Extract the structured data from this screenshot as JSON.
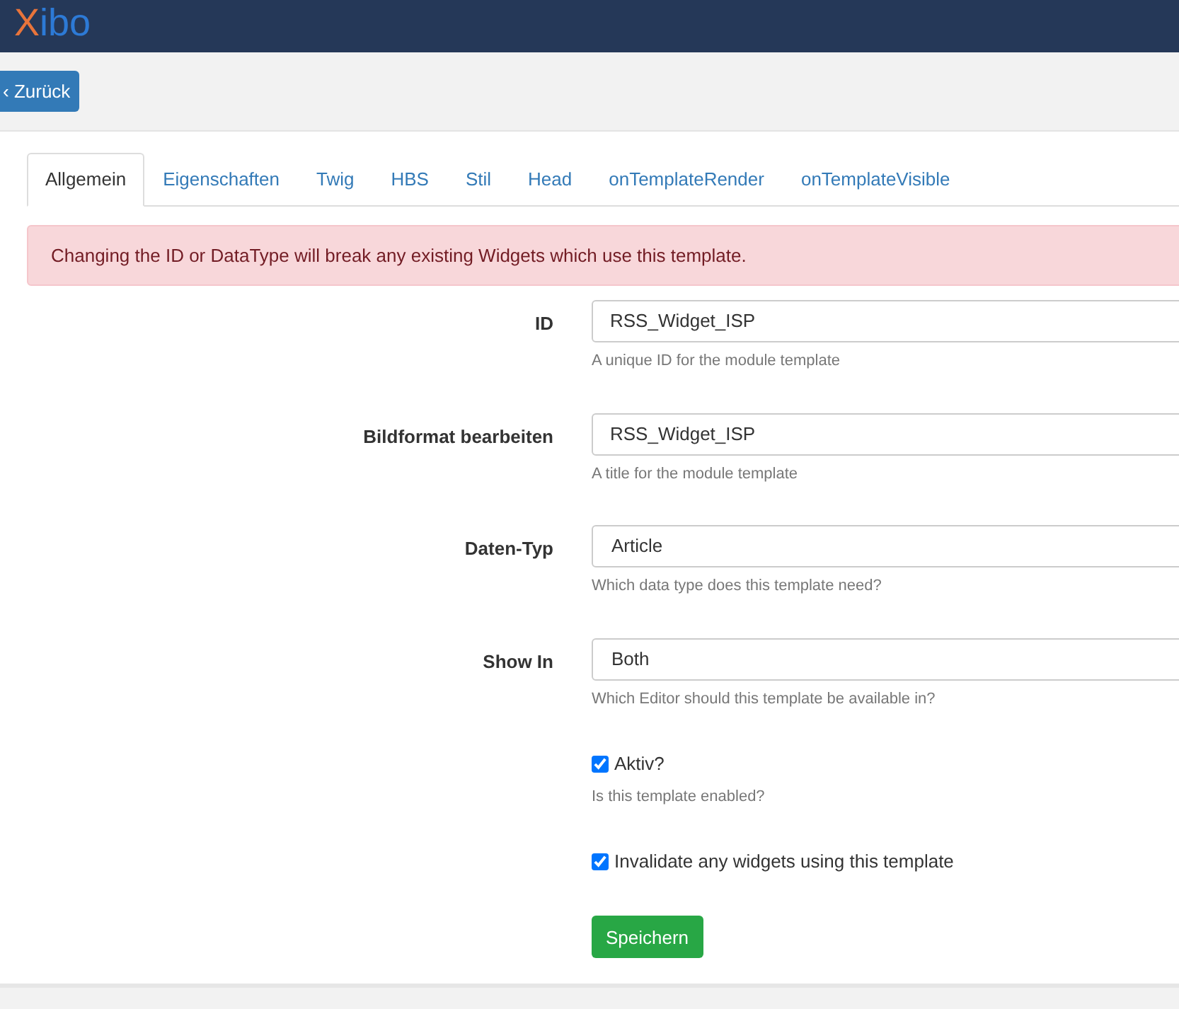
{
  "logo": {
    "text": "Xibo"
  },
  "back_button": {
    "label": "‹ Zurück"
  },
  "tabs": [
    {
      "label": "Allgemein",
      "selected": true
    },
    {
      "label": "Eigenschaften",
      "selected": false
    },
    {
      "label": "Twig",
      "selected": false
    },
    {
      "label": "HBS",
      "selected": false
    },
    {
      "label": "Stil",
      "selected": false
    },
    {
      "label": "Head",
      "selected": false
    },
    {
      "label": "onTemplateRender",
      "selected": false
    },
    {
      "label": "onTemplateVisible",
      "selected": false
    }
  ],
  "alert": {
    "text": "Changing the ID or DataType will break any existing Widgets which use this template."
  },
  "fields": [
    {
      "kind": "text",
      "label": "ID",
      "value": "RSS_Widget_ISP",
      "help": "A unique ID for the module template"
    },
    {
      "kind": "text",
      "label": "Bildformat bearbeiten",
      "value": "RSS_Widget_ISP",
      "help": "A title for the module template"
    },
    {
      "kind": "select",
      "label": "Daten-Typ",
      "value": "Article",
      "help": "Which data type does this template need?"
    },
    {
      "kind": "select",
      "label": "Show In",
      "value": "Both",
      "help": "Which Editor should this template be available in?"
    },
    {
      "kind": "checkbox",
      "label": "Aktiv?",
      "checked": true,
      "help": "Is this template enabled?"
    },
    {
      "kind": "checkbox",
      "label": "Invalidate any widgets using this template",
      "checked": true
    }
  ],
  "save_button": {
    "label": "Speichern"
  }
}
